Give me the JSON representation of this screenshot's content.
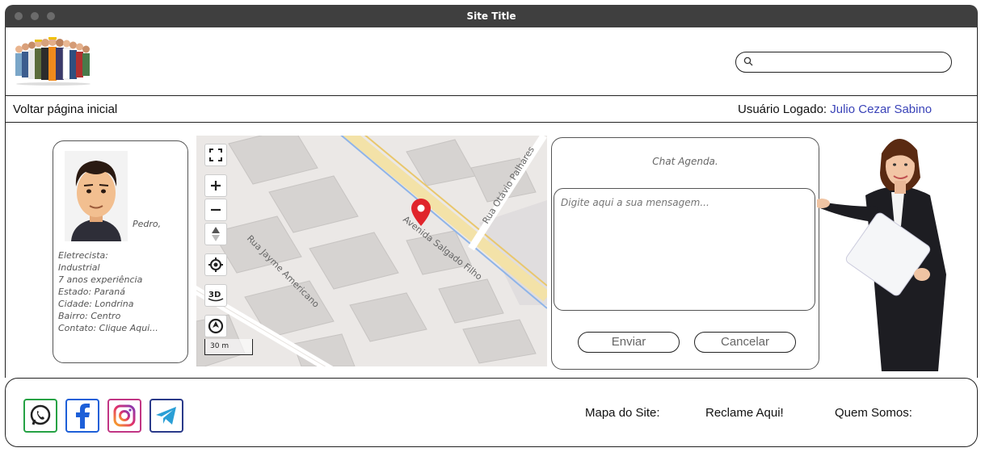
{
  "window": {
    "title": "Site Title"
  },
  "header": {
    "logo_icon": "workers-group-icon",
    "search": {
      "placeholder": "",
      "icon": "search-icon"
    }
  },
  "nav": {
    "back_label": "Voltar página inicial",
    "user_label": "Usuário Logado:",
    "user_name": "Julio Cezar Sabino"
  },
  "profile": {
    "name": "Pedro,",
    "details": [
      "Eletrecista:",
      "Industrial",
      "7 anos experiência",
      "Estado: Paraná",
      "Cidade: Londrina",
      "Bairro: Centro",
      "Contato: Clique Aqui..."
    ]
  },
  "map": {
    "streets": [
      "Rua Otávio Palhares",
      "Avenida Salgado Filho",
      "Rua Jayme Americano"
    ],
    "scale": "30 m",
    "controls": [
      "fullscreen-icon",
      "zoom-in-icon",
      "zoom-out-icon",
      "compass-icon",
      "locate-icon",
      "3d-icon",
      "rotate-icon"
    ],
    "marker_color": "#e0242b"
  },
  "chat": {
    "title": "Chat Agenda.",
    "placeholder": "Digite aqui a sua mensagem...",
    "send_label": "Enviar",
    "cancel_label": "Cancelar"
  },
  "footer": {
    "social": [
      {
        "name": "whatsapp",
        "color": "#25a244"
      },
      {
        "name": "facebook",
        "color": "#1d5fd8"
      },
      {
        "name": "instagram",
        "color": "#c13584"
      },
      {
        "name": "telegram",
        "color": "#2a9fd6"
      }
    ],
    "links": [
      "Mapa do Site:",
      "Reclame Aqui!",
      "Quem Somos:"
    ]
  },
  "colors": {
    "user_name": "#3a43b8",
    "titlebar": "#3f3f3f"
  }
}
